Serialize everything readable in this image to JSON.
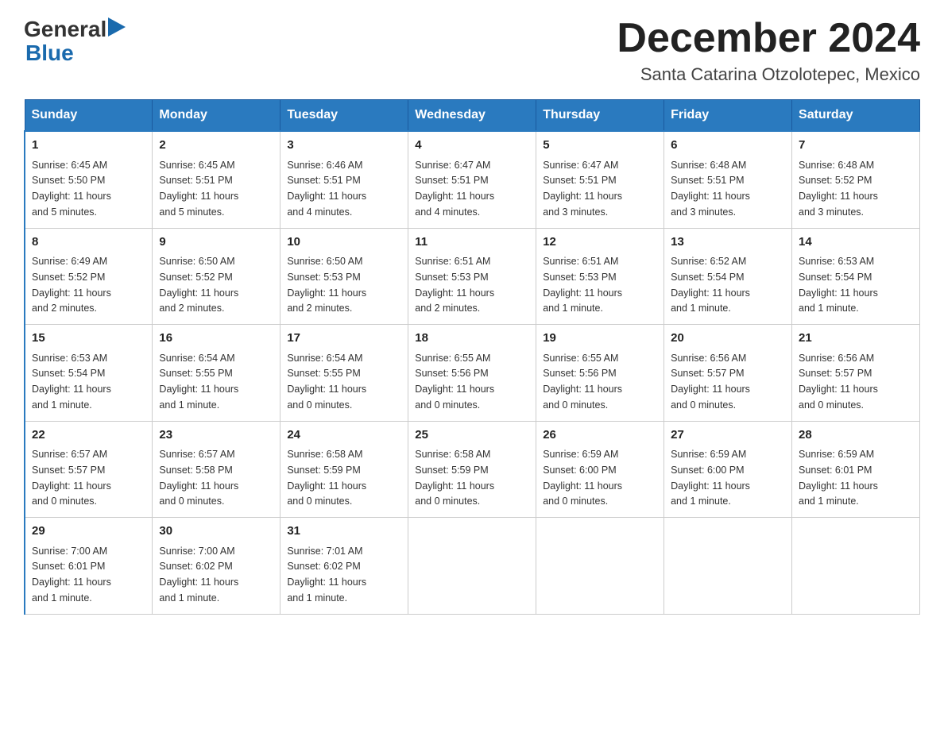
{
  "header": {
    "logo_general": "General",
    "logo_blue": "Blue",
    "month_title": "December 2024",
    "subtitle": "Santa Catarina Otzolotepec, Mexico"
  },
  "weekdays": [
    "Sunday",
    "Monday",
    "Tuesday",
    "Wednesday",
    "Thursday",
    "Friday",
    "Saturday"
  ],
  "weeks": [
    [
      {
        "day": "1",
        "sunrise": "6:45 AM",
        "sunset": "5:50 PM",
        "daylight": "11 hours and 5 minutes."
      },
      {
        "day": "2",
        "sunrise": "6:45 AM",
        "sunset": "5:51 PM",
        "daylight": "11 hours and 5 minutes."
      },
      {
        "day": "3",
        "sunrise": "6:46 AM",
        "sunset": "5:51 PM",
        "daylight": "11 hours and 4 minutes."
      },
      {
        "day": "4",
        "sunrise": "6:47 AM",
        "sunset": "5:51 PM",
        "daylight": "11 hours and 4 minutes."
      },
      {
        "day": "5",
        "sunrise": "6:47 AM",
        "sunset": "5:51 PM",
        "daylight": "11 hours and 3 minutes."
      },
      {
        "day": "6",
        "sunrise": "6:48 AM",
        "sunset": "5:51 PM",
        "daylight": "11 hours and 3 minutes."
      },
      {
        "day": "7",
        "sunrise": "6:48 AM",
        "sunset": "5:52 PM",
        "daylight": "11 hours and 3 minutes."
      }
    ],
    [
      {
        "day": "8",
        "sunrise": "6:49 AM",
        "sunset": "5:52 PM",
        "daylight": "11 hours and 2 minutes."
      },
      {
        "day": "9",
        "sunrise": "6:50 AM",
        "sunset": "5:52 PM",
        "daylight": "11 hours and 2 minutes."
      },
      {
        "day": "10",
        "sunrise": "6:50 AM",
        "sunset": "5:53 PM",
        "daylight": "11 hours and 2 minutes."
      },
      {
        "day": "11",
        "sunrise": "6:51 AM",
        "sunset": "5:53 PM",
        "daylight": "11 hours and 2 minutes."
      },
      {
        "day": "12",
        "sunrise": "6:51 AM",
        "sunset": "5:53 PM",
        "daylight": "11 hours and 1 minute."
      },
      {
        "day": "13",
        "sunrise": "6:52 AM",
        "sunset": "5:54 PM",
        "daylight": "11 hours and 1 minute."
      },
      {
        "day": "14",
        "sunrise": "6:53 AM",
        "sunset": "5:54 PM",
        "daylight": "11 hours and 1 minute."
      }
    ],
    [
      {
        "day": "15",
        "sunrise": "6:53 AM",
        "sunset": "5:54 PM",
        "daylight": "11 hours and 1 minute."
      },
      {
        "day": "16",
        "sunrise": "6:54 AM",
        "sunset": "5:55 PM",
        "daylight": "11 hours and 1 minute."
      },
      {
        "day": "17",
        "sunrise": "6:54 AM",
        "sunset": "5:55 PM",
        "daylight": "11 hours and 0 minutes."
      },
      {
        "day": "18",
        "sunrise": "6:55 AM",
        "sunset": "5:56 PM",
        "daylight": "11 hours and 0 minutes."
      },
      {
        "day": "19",
        "sunrise": "6:55 AM",
        "sunset": "5:56 PM",
        "daylight": "11 hours and 0 minutes."
      },
      {
        "day": "20",
        "sunrise": "6:56 AM",
        "sunset": "5:57 PM",
        "daylight": "11 hours and 0 minutes."
      },
      {
        "day": "21",
        "sunrise": "6:56 AM",
        "sunset": "5:57 PM",
        "daylight": "11 hours and 0 minutes."
      }
    ],
    [
      {
        "day": "22",
        "sunrise": "6:57 AM",
        "sunset": "5:57 PM",
        "daylight": "11 hours and 0 minutes."
      },
      {
        "day": "23",
        "sunrise": "6:57 AM",
        "sunset": "5:58 PM",
        "daylight": "11 hours and 0 minutes."
      },
      {
        "day": "24",
        "sunrise": "6:58 AM",
        "sunset": "5:59 PM",
        "daylight": "11 hours and 0 minutes."
      },
      {
        "day": "25",
        "sunrise": "6:58 AM",
        "sunset": "5:59 PM",
        "daylight": "11 hours and 0 minutes."
      },
      {
        "day": "26",
        "sunrise": "6:59 AM",
        "sunset": "6:00 PM",
        "daylight": "11 hours and 0 minutes."
      },
      {
        "day": "27",
        "sunrise": "6:59 AM",
        "sunset": "6:00 PM",
        "daylight": "11 hours and 1 minute."
      },
      {
        "day": "28",
        "sunrise": "6:59 AM",
        "sunset": "6:01 PM",
        "daylight": "11 hours and 1 minute."
      }
    ],
    [
      {
        "day": "29",
        "sunrise": "7:00 AM",
        "sunset": "6:01 PM",
        "daylight": "11 hours and 1 minute."
      },
      {
        "day": "30",
        "sunrise": "7:00 AM",
        "sunset": "6:02 PM",
        "daylight": "11 hours and 1 minute."
      },
      {
        "day": "31",
        "sunrise": "7:01 AM",
        "sunset": "6:02 PM",
        "daylight": "11 hours and 1 minute."
      },
      null,
      null,
      null,
      null
    ]
  ],
  "labels": {
    "sunrise": "Sunrise:",
    "sunset": "Sunset:",
    "daylight": "Daylight:"
  }
}
